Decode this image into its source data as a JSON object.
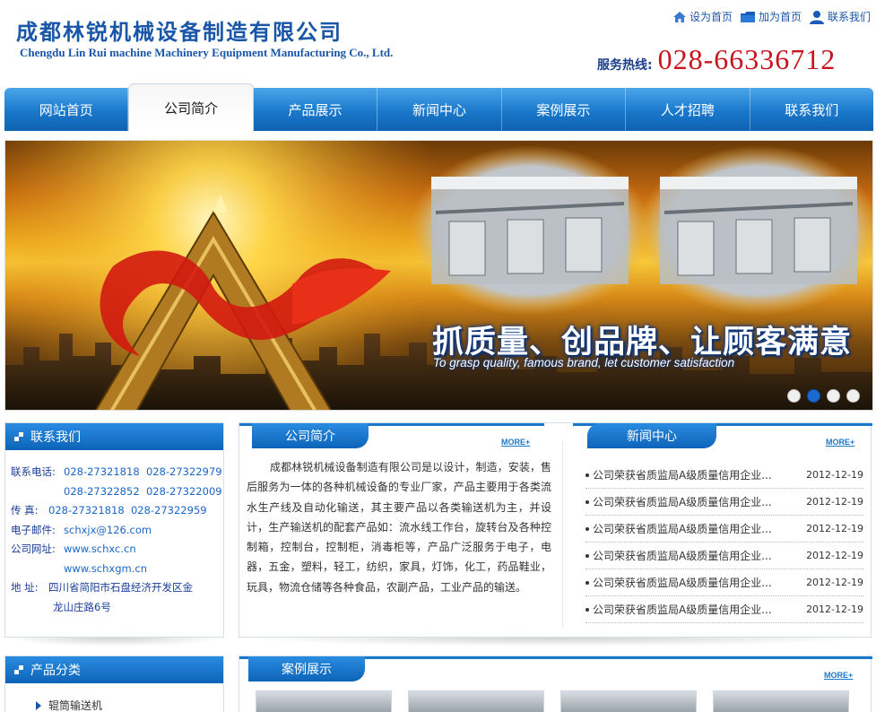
{
  "header": {
    "company_cn": "成都林锐机械设备制造有限公司",
    "company_en": "Chengdu Lin Rui machine Machinery Equipment Manufacturing Co., Ltd.",
    "links": [
      {
        "label": "设为首页",
        "icon": "home-icon"
      },
      {
        "label": "加为首页",
        "icon": "folder-icon"
      },
      {
        "label": "联系我们",
        "icon": "user-icon"
      }
    ],
    "hotline_label": "服务热线:",
    "hotline_number": "028-66336712"
  },
  "nav": {
    "items": [
      "网站首页",
      "公司简介",
      "产品展示",
      "新闻中心",
      "案例展示",
      "人才招聘",
      "联系我们"
    ],
    "active_index": 1
  },
  "banner": {
    "slogan_cn": "抓质量、创品牌、让顾客满意",
    "slogan_en": "To grasp quality, famous brand, let customer satisfaction",
    "dots": 4,
    "active_dot": 1
  },
  "contact": {
    "title": "联系我们",
    "phone_label": "联系电话:",
    "phones_line1": "028-27321818  028-27322979",
    "phones_line2": "028-27322852  028-27322009",
    "fax_label": "传  真:",
    "fax": "028-27321818  028-27322959",
    "email_label": "电子邮件:",
    "email": "schxjx@126.com",
    "web_label": "公司网址:",
    "web1": "www.schxc.cn",
    "web2": "www.schxgm.cn",
    "addr_label": "地  址:",
    "addr_line1": "四川省简阳市石盘经济开发区金",
    "addr_line2": "龙山庄路6号"
  },
  "about": {
    "title": "公司简介",
    "more": "MORE+",
    "text": "成都林锐机械设备制造有限公司是以设计，制造，安装，售后服务为一体的各种机械设备的专业厂家，产品主要用于各类流水生产线及自动化输送，其主要产品以各类输送机为主，并设计，生产输送机的配套产品如：流水线工作台，旋转台及各种控制箱，控制台，控制柜，消毒柜等，产品广泛服务于电子，电器，五金，塑料，轻工，纺织，家具，灯饰，化工，药品鞋业，玩具，物流仓储等各种食品，农副产品，工业产品的输送。"
  },
  "news": {
    "title": "新闻中心",
    "more": "MORE+",
    "items": [
      {
        "title": "公司荣获省质监局A级质量信用企业...",
        "date": "2012-12-19"
      },
      {
        "title": "公司荣获省质监局A级质量信用企业...",
        "date": "2012-12-19"
      },
      {
        "title": "公司荣获省质监局A级质量信用企业...",
        "date": "2012-12-19"
      },
      {
        "title": "公司荣获省质监局A级质量信用企业...",
        "date": "2012-12-19"
      },
      {
        "title": "公司荣获省质监局A级质量信用企业...",
        "date": "2012-12-19"
      },
      {
        "title": "公司荣获省质监局A级质量信用企业...",
        "date": "2012-12-19"
      }
    ]
  },
  "products": {
    "title": "产品分类",
    "items": [
      "辊筒输送机"
    ]
  },
  "cases": {
    "title": "案例展示",
    "more": "MORE+"
  },
  "colors": {
    "brand_blue": "#1a78cc",
    "hotline_red": "#c8141e",
    "title_blue": "#1a56a8"
  }
}
